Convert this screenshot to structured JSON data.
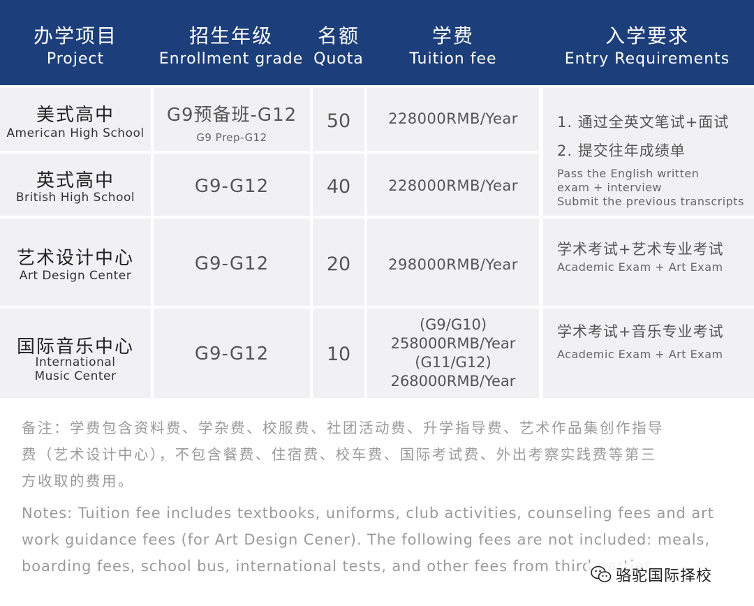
{
  "header": [
    {
      "zh": "办学项目",
      "en": "Project"
    },
    {
      "zh": "招生年级",
      "en": "Enrollment grade"
    },
    {
      "zh": "名额",
      "en": "Quota"
    },
    {
      "zh": "学费",
      "en": "Tuition fee"
    },
    {
      "zh": "入学要求",
      "en": "Entry Requirements"
    }
  ],
  "rows": [
    {
      "project_zh": "美式高中",
      "project_en": "American High School",
      "grade": "G9预备班-G12",
      "grade_sub": "G9 Prep-G12",
      "quota": "50",
      "fee": "228000RMB/Year"
    },
    {
      "project_zh": "英式高中",
      "project_en": "British High School",
      "grade": "G9-G12",
      "quota": "40",
      "fee": "228000RMB/Year"
    },
    {
      "project_zh": "艺术设计中心",
      "project_en": "Art Design Center",
      "grade": "G9-G12",
      "quota": "20",
      "fee": "298000RMB/Year"
    },
    {
      "project_zh": "国际音乐中心",
      "project_en_1": "International",
      "project_en_2": "Music Center",
      "grade": "G9-G12",
      "quota": "10",
      "fee_lines": [
        "(G9/G10)",
        "258000RMB/Year",
        "(G11/G12)",
        "268000RMB/Year"
      ]
    }
  ],
  "requirements": [
    {
      "zh_lines": [
        "1. 通过全英文笔试+面试",
        "2. 提交往年成绩单"
      ],
      "en_lines": [
        "Pass the English written",
        "exam + interview",
        "Submit the previous transcripts"
      ]
    },
    {
      "zh": "学术考试+艺术专业考试",
      "en": "Academic Exam + Art Exam"
    },
    {
      "zh": "学术考试+音乐专业考试",
      "en": "Academic Exam + Art Exam"
    }
  ],
  "notes": {
    "zh_lines": [
      "备注：学费包含资料费、学杂费、校服费、社团活动费、升学指导费、艺术作品集创作指导",
      "费（艺术设计中心），不包含餐费、住宿费、校车费、国际考试费、外出考察实践费等第三",
      "方收取的费用。"
    ],
    "en_lines": [
      "Notes: Tuition fee includes textbooks, uniforms, club activities, counseling fees and art",
      "work guidance fees (for Art Design Cener). The following fees are not included: meals,",
      "boarding fees, school bus, international tests, and other fees from third parties."
    ]
  },
  "watermark": {
    "text": "骆驼国际择校",
    "icon": "wechat-icon"
  },
  "colors": {
    "header_bg": "#1c3e7a",
    "cell_bg": "#f1f1f3",
    "notes_text": "#9a9a9a"
  }
}
